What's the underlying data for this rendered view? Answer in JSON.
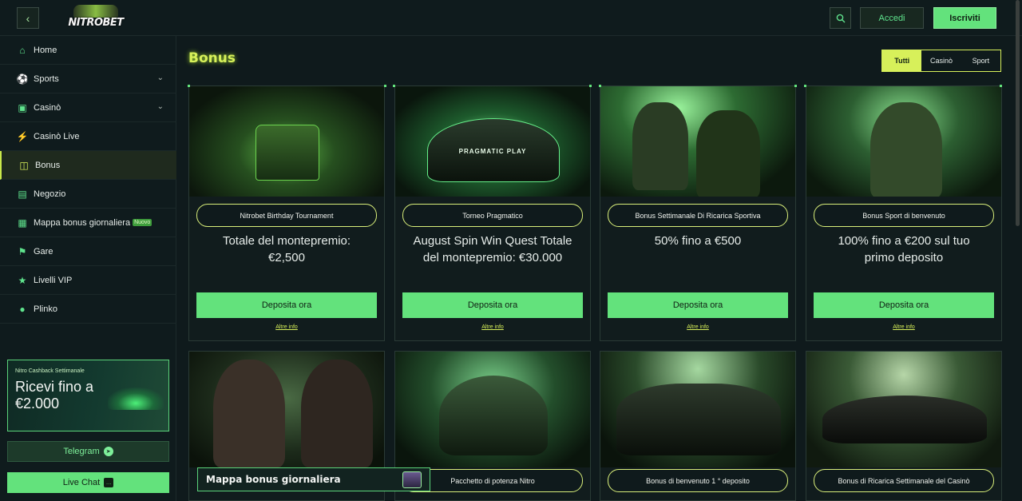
{
  "header": {
    "logo_text": "NITROBET",
    "login_label": "Accedi",
    "register_label": "Iscriviti"
  },
  "sidebar": {
    "items": [
      {
        "label": "Home",
        "icon": "home-icon"
      },
      {
        "label": "Sports",
        "icon": "soccer-ball-icon",
        "expandable": true
      },
      {
        "label": "Casinò",
        "icon": "gamepad-icon",
        "expandable": true
      },
      {
        "label": "Casinò Live",
        "icon": "lightning-icon"
      },
      {
        "label": "Bonus",
        "icon": "gift-icon",
        "active": true
      },
      {
        "label": "Negozio",
        "icon": "cart-icon"
      },
      {
        "label": "Mappa bonus giornaliera",
        "icon": "calendar-icon",
        "badge": "Nuovo"
      },
      {
        "label": "Gare",
        "icon": "trophy-icon"
      },
      {
        "label": "Livelli VIP",
        "icon": "star-icon"
      },
      {
        "label": "Plinko",
        "icon": "plinko-icon"
      }
    ],
    "promo": {
      "title": "Nitro Cashback Settimanale",
      "text": "Ricevi fino a €2.000"
    },
    "telegram_label": "Telegram",
    "livechat_label": "Live Chat"
  },
  "main": {
    "title": "Bonus",
    "filters": [
      {
        "label": "Tutti",
        "active": true
      },
      {
        "label": "Casinò",
        "active": false
      },
      {
        "label": "Sport",
        "active": false
      }
    ],
    "cards": [
      {
        "tag": "Nitrobet Birthday Tournament",
        "desc": "Totale del montepremio: €2,500",
        "cta": "Deposita ora",
        "more": "Altre info"
      },
      {
        "tag": "Torneo Pragmatico",
        "desc": "August Spin Win Quest Totale del montepremio: €30.000",
        "cta": "Deposita ora",
        "more": "Altre info",
        "image_text": "PRAGMATIC PLAY"
      },
      {
        "tag": "Bonus Settimanale Di Ricarica Sportiva",
        "desc": "50% fino a €500",
        "cta": "Deposita ora",
        "more": "Altre info"
      },
      {
        "tag": "Bonus Sport di benvenuto",
        "desc": "100% fino a €200 sul tuo primo deposito",
        "cta": "Deposita ora",
        "more": "Altre info"
      },
      {
        "tag": "",
        "desc": "",
        "cta": "",
        "more": ""
      },
      {
        "tag": "Pacchetto di potenza Nitro",
        "desc": "",
        "cta": "",
        "more": ""
      },
      {
        "tag": "Bonus di benvenuto 1 ° deposito",
        "desc": "",
        "cta": "",
        "more": ""
      },
      {
        "tag": "Bonus di Ricarica Settimanale del Casinò",
        "desc": "",
        "cta": "",
        "more": ""
      }
    ]
  },
  "map_banner": {
    "label": "Mappa bonus giornaliera"
  },
  "colors": {
    "accent": "#63e27c",
    "highlight": "#d7f05a",
    "background": "#0f1a1c"
  }
}
